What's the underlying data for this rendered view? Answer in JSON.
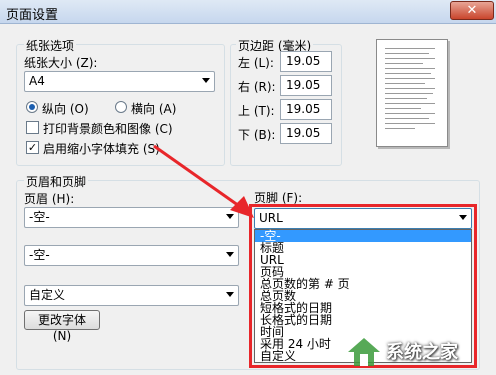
{
  "window": {
    "title": "页面设置",
    "close_glyph": "✕"
  },
  "paper": {
    "group_label": "纸张选项",
    "size_label": "纸张大小 (Z):",
    "size_value": "A4",
    "orientation": {
      "portrait": "纵向 (O)",
      "landscape": "横向 (A)",
      "selected": "portrait"
    },
    "print_background": {
      "label": "打印背景颜色和图像 (C)",
      "checked": false
    },
    "shrink_to_fit": {
      "label": "启用缩小字体填充 (S)",
      "checked": true,
      "mark": "✓"
    }
  },
  "margins": {
    "group_label": "页边距 (毫米)",
    "left": {
      "label": "左 (L):",
      "value": "19.05"
    },
    "right": {
      "label": "右 (R):",
      "value": "19.05"
    },
    "top": {
      "label": "上 (T):",
      "value": "19.05"
    },
    "bottom": {
      "label": "下 (B):",
      "value": "19.05"
    }
  },
  "header_footer": {
    "group_label": "页眉和页脚",
    "header_label": "页眉 (H):",
    "header_values": [
      "-空-",
      "-空-",
      "自定义"
    ],
    "change_font_button": "更改字体 (N)",
    "footer_label": "页脚 (F):",
    "footer_value": "URL",
    "footer_options": [
      "-空-",
      "标题",
      "URL",
      "页码",
      "总页数的第 # 页",
      "总页数",
      "短格式的日期",
      "长格式的日期",
      "时间",
      "采用 24 小时",
      "自定义"
    ],
    "footer_selected_index": 0
  },
  "colors": {
    "highlight": "#3399ff",
    "annotation_red": "#e8262a"
  },
  "watermark": {
    "text": "系统之家"
  }
}
